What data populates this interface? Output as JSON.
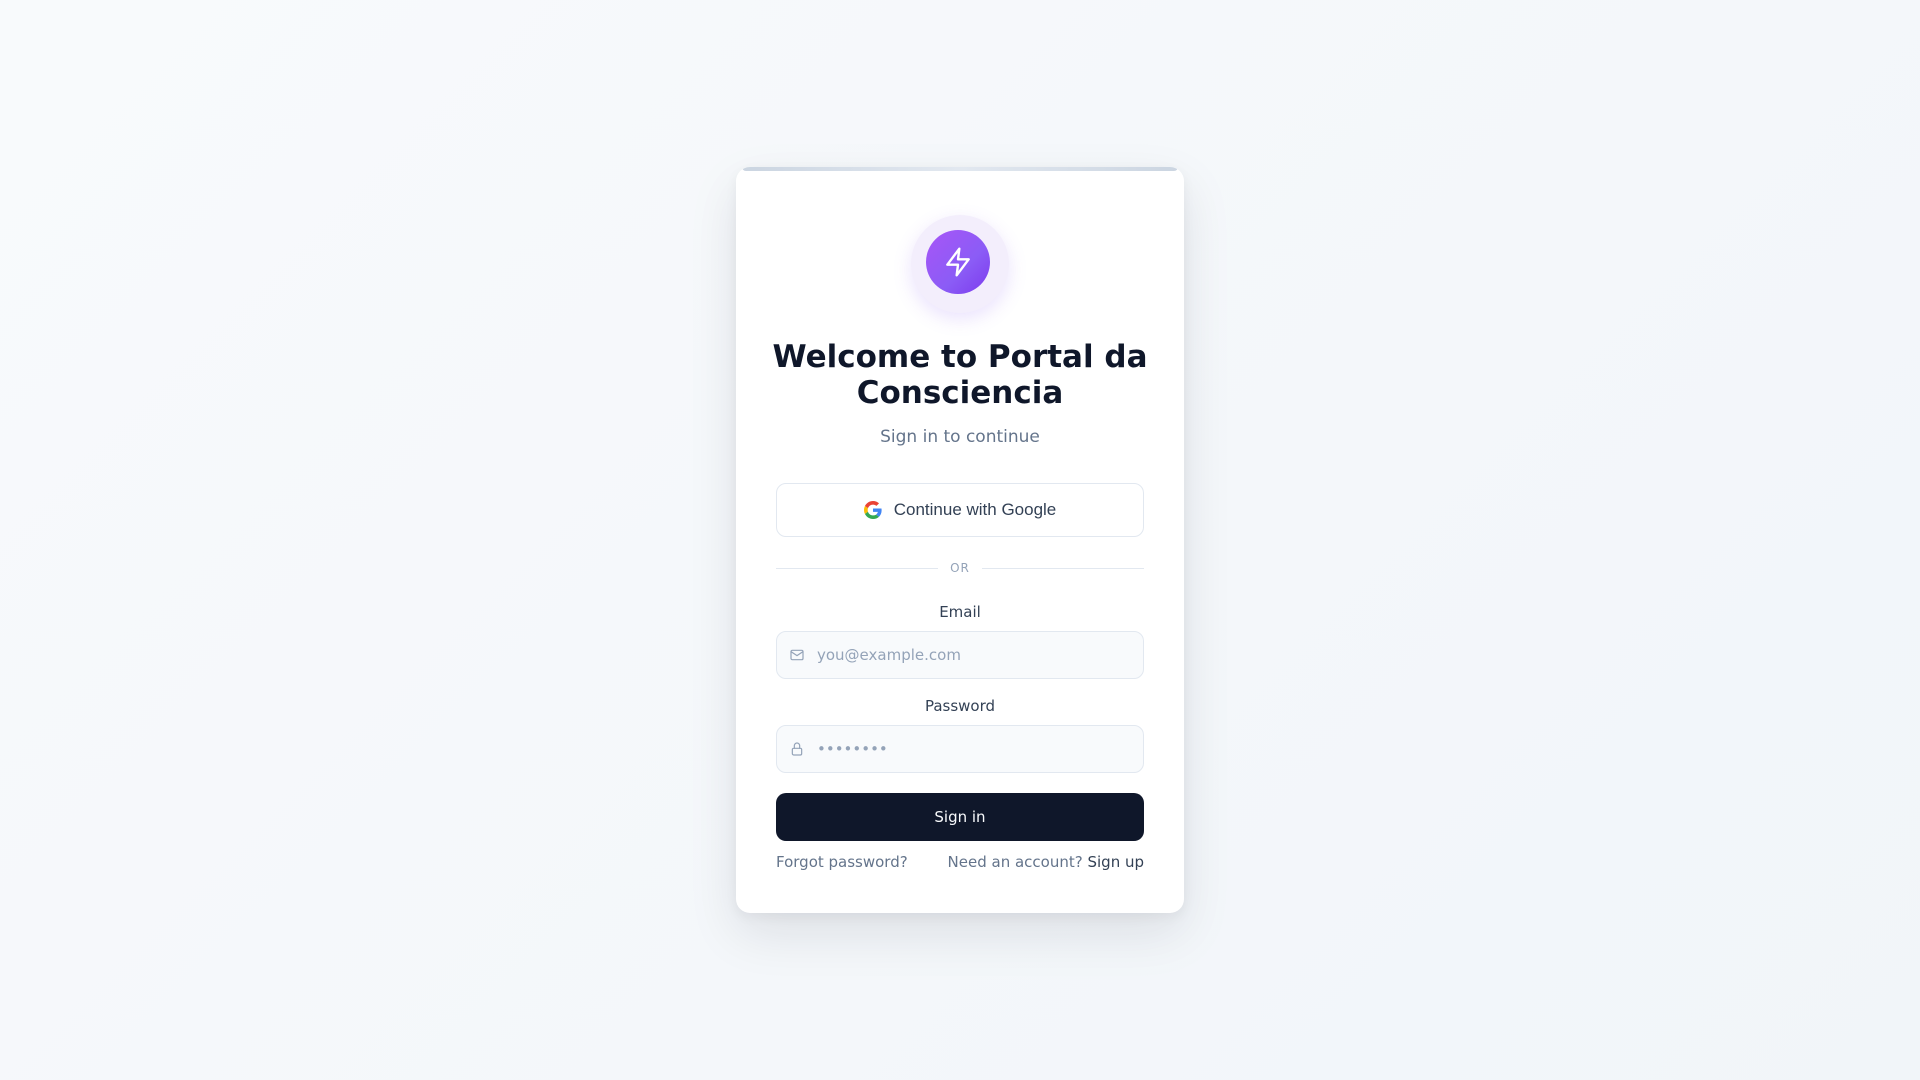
{
  "card": {
    "title": "Welcome to Portal da Consciencia",
    "subtitle": "Sign in to continue",
    "logo_icon": "lightning-bolt-icon"
  },
  "google_button": {
    "label": "Continue with Google",
    "icon": "google-icon"
  },
  "divider_text": "OR",
  "email": {
    "label": "Email",
    "placeholder": "you@example.com",
    "value": "",
    "icon": "mail-icon"
  },
  "password": {
    "label": "Password",
    "placeholder": "••••••••",
    "value": "",
    "icon": "lock-icon"
  },
  "signin_button": {
    "label": "Sign in"
  },
  "footer": {
    "forgot_password": "Forgot password?",
    "need_account": "Need an account?",
    "sign_up": "Sign up"
  },
  "colors": {
    "primary_dark": "#0f172a",
    "accent_purple": "#8b5cf6",
    "muted_text": "#64748b",
    "border": "#e2e8f0",
    "background": "#f8fafc"
  }
}
